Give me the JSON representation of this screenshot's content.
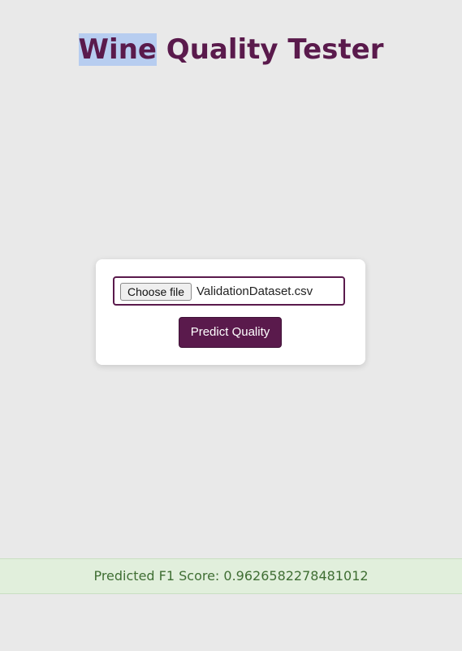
{
  "header": {
    "title_highlighted": "Wine",
    "title_rest": " Quality Tester"
  },
  "upload_form": {
    "choose_file_label": "Choose file",
    "selected_file": "ValidationDataset.csv",
    "submit_label": "Predict Quality"
  },
  "result": {
    "label": "Predicted F1 Score: ",
    "value": "0.9626582278481012"
  },
  "colors": {
    "background": "#e9e9e9",
    "brand": "#5a1a4c",
    "selection_highlight": "#b7cdf0",
    "result_background": "#e1efdc",
    "result_text": "#3f6e33"
  }
}
